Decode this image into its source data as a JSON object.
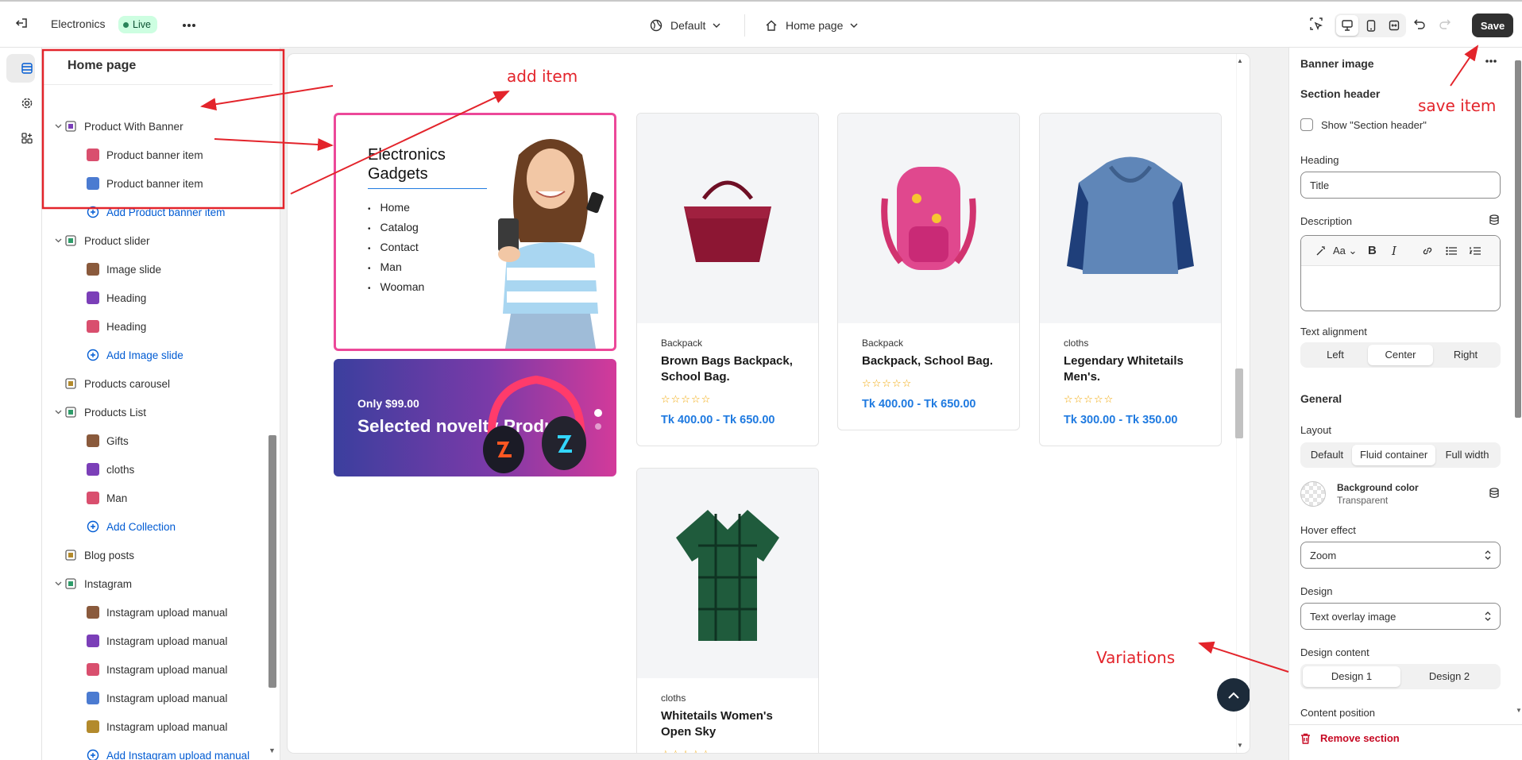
{
  "topbar": {
    "store_name": "Electronics",
    "status_badge": "Live",
    "theme": "Default",
    "page": "Home page",
    "save_label": "Save"
  },
  "sidebar": {
    "title": "Home page",
    "items": [
      {
        "label": "Product With Banner",
        "level": 0,
        "chevron": true
      },
      {
        "label": "Product banner item",
        "level": 1
      },
      {
        "label": "Product banner item",
        "level": 1
      },
      {
        "label": "Add Product banner item",
        "level": 1,
        "add": true
      },
      {
        "label": "Product slider",
        "level": 0,
        "chevron": true
      },
      {
        "label": "Image slide",
        "level": 1
      },
      {
        "label": "Heading",
        "level": 1
      },
      {
        "label": "Heading",
        "level": 1
      },
      {
        "label": "Add Image slide",
        "level": 1,
        "add": true
      },
      {
        "label": "Products carousel",
        "level": 0
      },
      {
        "label": "Products List",
        "level": 0,
        "chevron": true
      },
      {
        "label": "Gifts",
        "level": 1
      },
      {
        "label": "cloths",
        "level": 1
      },
      {
        "label": "Man",
        "level": 1
      },
      {
        "label": "Add Collection",
        "level": 1,
        "add": true
      },
      {
        "label": "Blog posts",
        "level": 0
      },
      {
        "label": "Instagram",
        "level": 0,
        "chevron": true
      },
      {
        "label": "Instagram upload manual",
        "level": 1
      },
      {
        "label": "Instagram upload manual",
        "level": 1
      },
      {
        "label": "Instagram upload manual",
        "level": 1
      },
      {
        "label": "Instagram upload manual",
        "level": 1
      },
      {
        "label": "Instagram upload manual",
        "level": 1
      },
      {
        "label": "Add Instagram upload manual",
        "level": 1,
        "add": true
      }
    ]
  },
  "canvas": {
    "banner": {
      "title_line1": "Electronics",
      "title_line2": "Gadgets",
      "menu": [
        "Home",
        "Catalog",
        "Contact",
        "Man",
        "Wooman"
      ]
    },
    "promo": {
      "price": "Only $99.00",
      "title": "Selected novelty Products"
    },
    "products": [
      {
        "category": "Backpack",
        "name": "Brown Bags Backpack, School Bag.",
        "price": "Tk 400.00 - Tk 650.00"
      },
      {
        "category": "Backpack",
        "name": "Backpack, School Bag.",
        "price": "Tk 400.00 - Tk 650.00"
      },
      {
        "category": "cloths",
        "name": "Legendary Whitetails Men's.",
        "price": "Tk 300.00 - Tk 350.00"
      },
      {
        "category": "cloths",
        "name": "Whitetails Women's Open Sky",
        "price": ""
      }
    ]
  },
  "rightpanel": {
    "title": "Banner image",
    "section_header": "Section header",
    "show_header_label": "Show \"Section header\"",
    "heading_label": "Heading",
    "heading_value": "Title",
    "description_label": "Description",
    "text_alignment_label": "Text alignment",
    "alignment": [
      "Left",
      "Center",
      "Right"
    ],
    "general": "General",
    "layout_label": "Layout",
    "layout": [
      "Default",
      "Fluid container",
      "Full width"
    ],
    "bg_color_label": "Background color",
    "bg_color_value": "Transparent",
    "hover_label": "Hover effect",
    "hover_value": "Zoom",
    "design_label": "Design",
    "design_value": "Text overlay image",
    "design_content_label": "Design content",
    "design_content": [
      "Design 1",
      "Design 2"
    ],
    "content_position_label": "Content position",
    "remove_section": "Remove section"
  },
  "annotations": {
    "add_item": "add item",
    "save_item": "save item",
    "variations": "Variations"
  },
  "colors": {
    "accent": "#005bd3",
    "annotation": "#e3242b",
    "live_badge": "#cdfee1",
    "banner_border": "#ec4899",
    "price": "#1f7ae0"
  }
}
